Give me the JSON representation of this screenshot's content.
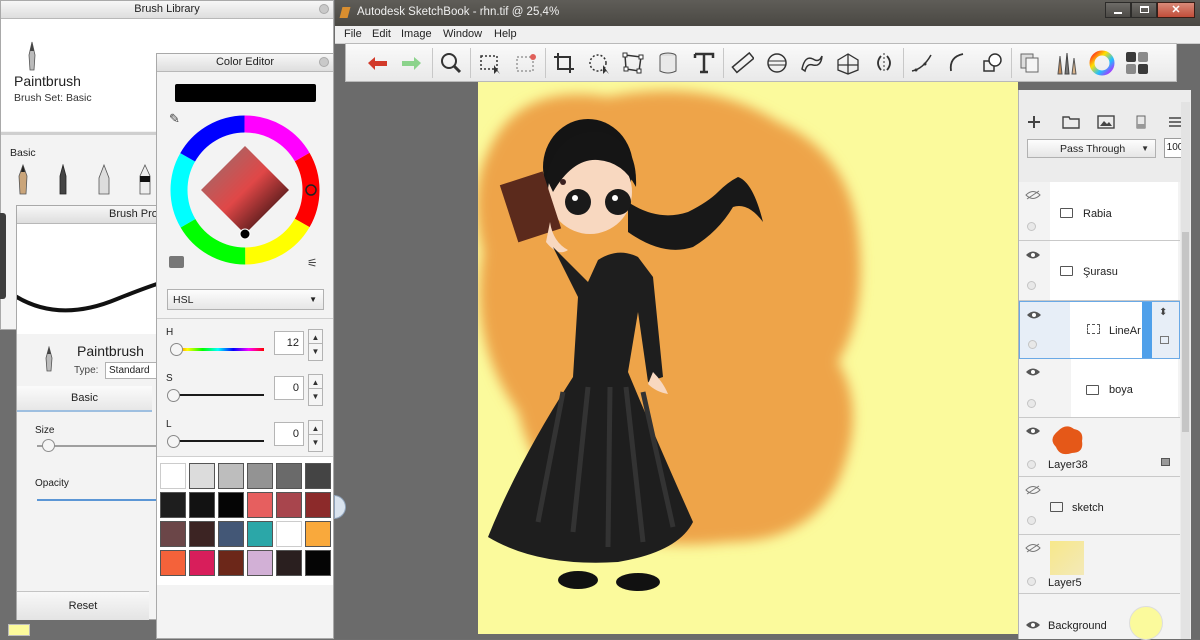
{
  "brush_library": {
    "title": "Brush Library",
    "brush_name": "Paintbrush",
    "brush_set": "Brush Set: Basic",
    "section": "Basic"
  },
  "brush_properties": {
    "title": "Brush Pro",
    "brush_name": "Paintbrush",
    "type_label": "Type:",
    "type_value": "Standard",
    "tab_basic": "Basic",
    "size_label": "Size",
    "opacity_label": "Opacity",
    "reset_label": "Reset"
  },
  "color_editor": {
    "title": "Color Editor",
    "mode": "HSL",
    "h_label": "H",
    "h_value": "12",
    "s_label": "S",
    "s_value": "0",
    "l_label": "L",
    "l_value": "0",
    "current_color": "#000000",
    "swatches": [
      "#ffffff",
      "#dcdcdc",
      "#bdbdbd",
      "#939393",
      "#6a6a6a",
      "#444444",
      "#1e1e1e",
      "#121212",
      "#050505",
      "#e65f5f",
      "#a8454d",
      "#8c2a2a",
      "#6b4648",
      "#3c2423",
      "#435776",
      "#2ba7a8",
      "#ffffff",
      "#f9a93c",
      "#f4623a",
      "#d81e5b",
      "#6c2719",
      "#d2b0d6",
      "#2a1f1f",
      "#050505"
    ]
  },
  "app": {
    "window_title": "Autodesk SketchBook - rhn.tif @ 25,4%",
    "menu": [
      "File",
      "Edit",
      "Image",
      "Window",
      "Help"
    ]
  },
  "layers": {
    "blend_mode": "Pass Through",
    "opacity": "100",
    "items": [
      {
        "name": "Rabia"
      },
      {
        "name": "Şurasu"
      },
      {
        "name": "LineAr"
      },
      {
        "name": "boya"
      },
      {
        "name": "Layer38"
      },
      {
        "name": "sketch"
      },
      {
        "name": "Layer5"
      },
      {
        "name": "Background"
      }
    ]
  }
}
